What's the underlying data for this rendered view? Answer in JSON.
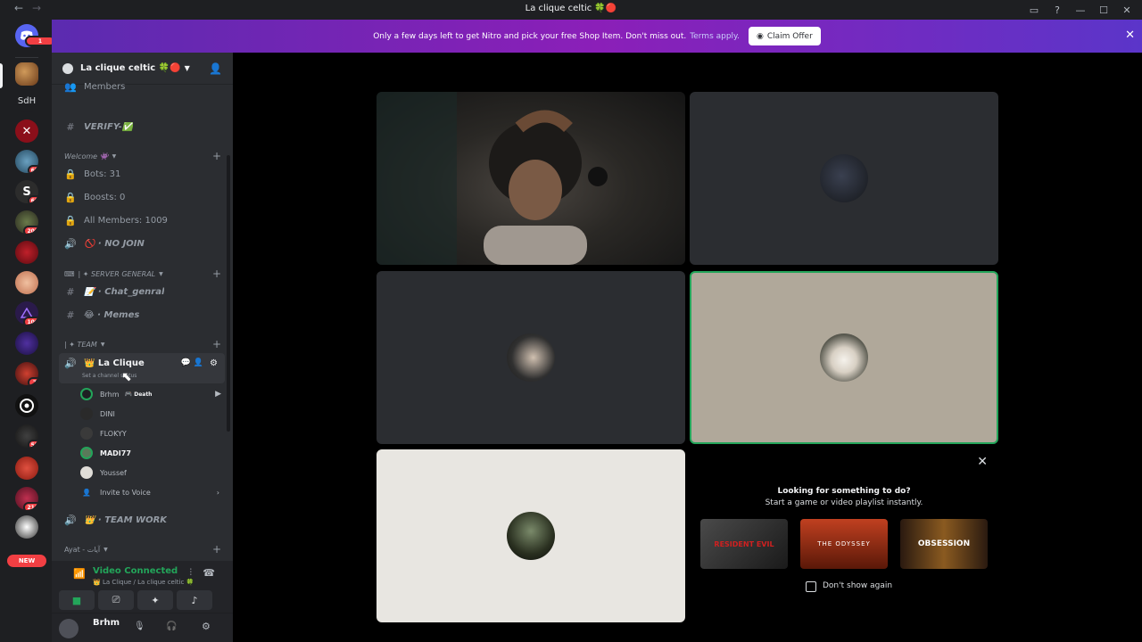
{
  "window": {
    "title": "La clique celtic 🍀🔴"
  },
  "banner": {
    "text": "Only a few days left to get Nitro and pick your free Shop Item. Don't miss out.",
    "link": "Terms apply.",
    "claim_label": "Claim Offer"
  },
  "guild_rail": {
    "badges": [
      "1",
      "67",
      "65",
      "205",
      "100",
      "7",
      "57",
      "213"
    ],
    "sdh_label": "SdH",
    "new_label": "NEW"
  },
  "server": {
    "name": "La clique celtic 🍀🔴"
  },
  "channels": {
    "members": "Members",
    "verify": "VERIFY-✅",
    "cat_welcome": "Welcome 👾",
    "bots": "Bots: 31",
    "boosts": "Boosts: 0",
    "all_members": "All Members: 1009",
    "no_join": "🚫 · NO JOIN",
    "cat_server_general": "| ✦ SERVER GENERAL",
    "chat_general": "📝 · Chat_genral",
    "memes": "😂 · Memes",
    "cat_team": "| ✦ TEAM",
    "la_clique": "👑 La Clique",
    "set_status": "Set a channel status",
    "users": [
      "Brhm",
      "DINI",
      "FLOKYY",
      "MADI77",
      "Youssef"
    ],
    "brhm_activity": "Death",
    "invite": "Invite to Voice",
    "team_work": "👑 · TEAM WORK",
    "cat_ayat": "Ayat - آيات"
  },
  "voice": {
    "status": "Video Connected",
    "sub": "👑 La Clique  / La clique celtic 🍀"
  },
  "user": {
    "name": "Brhm"
  },
  "promo": {
    "title": "Looking for something to do?",
    "subtitle": "Start a game or video playlist instantly.",
    "games": [
      "RESIDENT EVIL",
      "THE ODYSSEY",
      "OBSESSION"
    ],
    "dont_show": "Don't show again"
  },
  "colors": {
    "accent": "#5865f2",
    "speaking": "#23a55a",
    "danger": "#f23f43"
  }
}
